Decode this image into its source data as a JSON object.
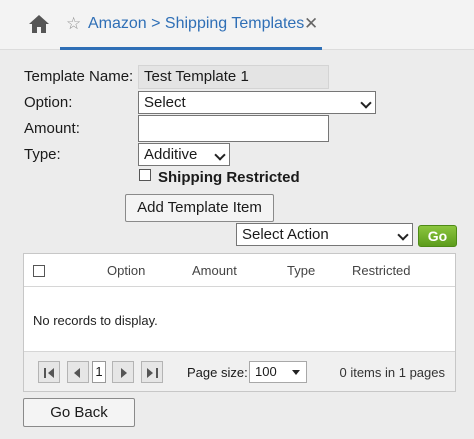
{
  "tabbar": {
    "home_icon": "home-icon",
    "star_icon": "star-icon",
    "tab_label": "Amazon > Shipping Templates",
    "close_glyph": "✕",
    "accent": "#2f6fb6"
  },
  "form": {
    "template_name_label": "Template Name:",
    "template_name_value": "Test Template 1",
    "option_label": "Option:",
    "option_value": "Select",
    "amount_label": "Amount:",
    "amount_value": "",
    "type_label": "Type:",
    "type_value": "Additive",
    "shipping_restricted_label": "Shipping Restricted",
    "shipping_restricted_checked": false,
    "add_item_button": "Add Template Item",
    "action_select_value": "Select Action",
    "go_button": "Go"
  },
  "grid": {
    "columns": [
      "Option",
      "Amount",
      "Type",
      "Restricted"
    ],
    "empty_message": "No records to display.",
    "pager": {
      "current_page": "1",
      "page_size_label": "Page size:",
      "page_size_value": "100",
      "info": "0 items in 1 pages"
    }
  },
  "footer": {
    "go_back_button": "Go Back"
  }
}
